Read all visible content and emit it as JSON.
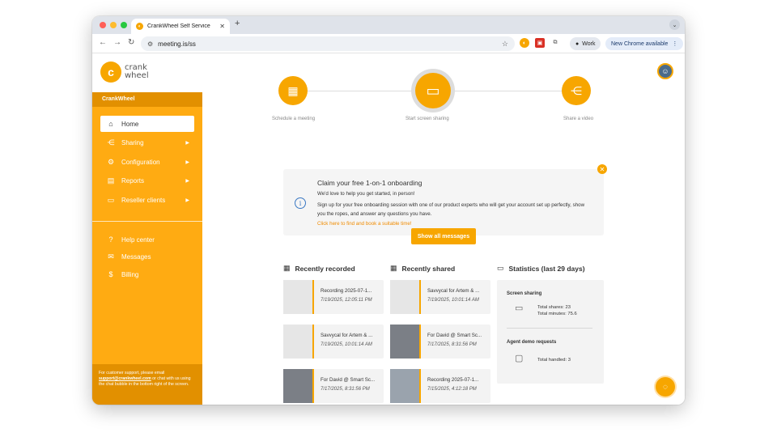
{
  "browser": {
    "tab_title": "CrankWheel Self Service",
    "tab_close": "✕",
    "new_tab": "+",
    "url": "meeting.is/ss",
    "profile_label": "Work",
    "update_label": "New Chrome available"
  },
  "colors": {
    "brand": "#f7a600",
    "sidebar": "#ffab12",
    "sidebar_dark": "#e29000",
    "link": "#f08b00",
    "info": "#3a78c3"
  },
  "sidebar": {
    "logo_line1": "crank",
    "logo_line2": "wheel",
    "account": "CrankWheel",
    "items": [
      {
        "label": "Home",
        "icon": "home-icon",
        "active": true
      },
      {
        "label": "Sharing",
        "icon": "share-icon",
        "arrow": "▶"
      },
      {
        "label": "Configuration",
        "icon": "gear-icon",
        "arrow": "▶"
      },
      {
        "label": "Reports",
        "icon": "report-icon",
        "arrow": "▶"
      },
      {
        "label": "Reseller clients",
        "icon": "briefcase-icon",
        "arrow": "▶"
      }
    ],
    "items2": [
      {
        "label": "Help center",
        "icon": "help-icon"
      },
      {
        "label": "Messages",
        "icon": "mail-icon"
      },
      {
        "label": "Billing",
        "icon": "dollar-icon"
      }
    ],
    "support_pre": "For customer support, please email ",
    "support_email": "support@crankwheel.com",
    "support_post": " or chat with us using the chat bubble in the bottom right of the screen."
  },
  "steps": [
    {
      "label": "Schedule a meeting"
    },
    {
      "label": "Start screen sharing"
    },
    {
      "label": "Share a video"
    }
  ],
  "notice": {
    "title": "Claim your free 1-on-1 onboarding",
    "line1": "We'd love to help you get started, in person!",
    "line2": "Sign up for your free onboarding session with one of our product experts who will get your account set up perfectly, show you the ropes, and answer any questions you have.",
    "link": "Click here to find and book a suitable time!"
  },
  "show_all": "Show all messages",
  "recorded": {
    "title": "Recently recorded",
    "items": [
      {
        "title": "Recording 2025-07-1...",
        "date": "7/19/2025, 12:05:11 PM"
      },
      {
        "title": "Savvycal for Artem & ...",
        "date": "7/19/2025, 10:01:14 AM"
      },
      {
        "title": "For David @ Smart Sc...",
        "date": "7/17/2025, 8:31:56 PM"
      }
    ]
  },
  "shared": {
    "title": "Recently shared",
    "items": [
      {
        "title": "Savvycal for Artem & ...",
        "date": "7/19/2025, 10:01:14 AM"
      },
      {
        "title": "For David @ Smart Sc...",
        "date": "7/17/2025, 8:31:56 PM"
      },
      {
        "title": "Recording 2025-07-1...",
        "date": "7/15/2025, 4:12:18 PM"
      }
    ]
  },
  "stats": {
    "title": "Statistics (last 29 days)",
    "screen_label": "Screen sharing",
    "total_shares_label": "Total shares:",
    "total_shares": "23",
    "total_minutes_label": "Total minutes:",
    "total_minutes": "75.6",
    "agent_label": "Agent demo requests",
    "total_handled_label": "Total handled:",
    "total_handled": "3"
  }
}
